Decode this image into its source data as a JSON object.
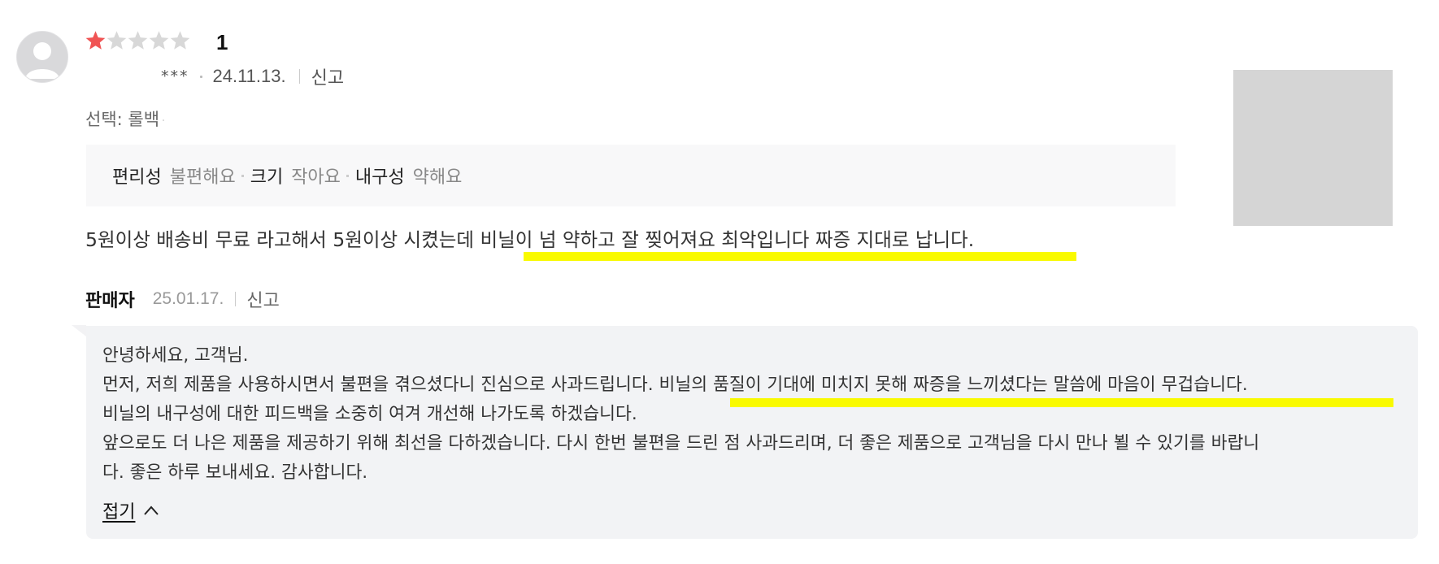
{
  "review": {
    "rating": "1",
    "stars_filled": 1,
    "stars_total": 5,
    "author_masked": "***",
    "date": "24.11.13.",
    "report_label": "신고",
    "selection": "선택: 롤백",
    "evaluations": [
      {
        "key": "편리성",
        "value": "불편해요"
      },
      {
        "key": "크기",
        "value": "작아요"
      },
      {
        "key": "내구성",
        "value": "약해요"
      }
    ],
    "text_part1": "5원이상 배송비 무료 라고해서 5원이상 시켰는데 ",
    "text_part2": "비닐이 넘 약하고 잘 찢어져요 최악입니다 짜증 지대로 납니다."
  },
  "seller": {
    "name": "판매자",
    "date": "25.01.17.",
    "report_label": "신고",
    "lines": [
      "안녕하세요, 고객님.",
      "먼저, 저희 제품을 사용하시면서 불편을 겪으셨다니 진심으로 사과드립니다. 비닐의 품질이 기대에 미치지 못해 짜증을 느끼셨다는 말씀에 마음이 무겁습니다.",
      "비닐의 내구성에 대한 피드백을 소중히 여겨 개선해 나가도록 하겠습니다.",
      "앞으로도 더 나은 제품을 제공하기 위해 최선을 다하겠습니다. 다시 한번 불편을 드린 점 사과드리며, 더 좋은 제품으로 고객님을 다시 만나 뵐 수 있기를 바랍니",
      "다. 좋은 하루 보내세요. 감사합니다."
    ],
    "fold_label": "접기"
  },
  "colors": {
    "star_filled": "#f05454",
    "star_empty": "#d8d8d8",
    "highlight": "#f9fa00",
    "reply_bg": "#f2f3f5",
    "eval_bg": "#f8f8f9"
  },
  "icons": [
    "avatar-placeholder-icon",
    "star-icon",
    "chevron-up-icon"
  ]
}
